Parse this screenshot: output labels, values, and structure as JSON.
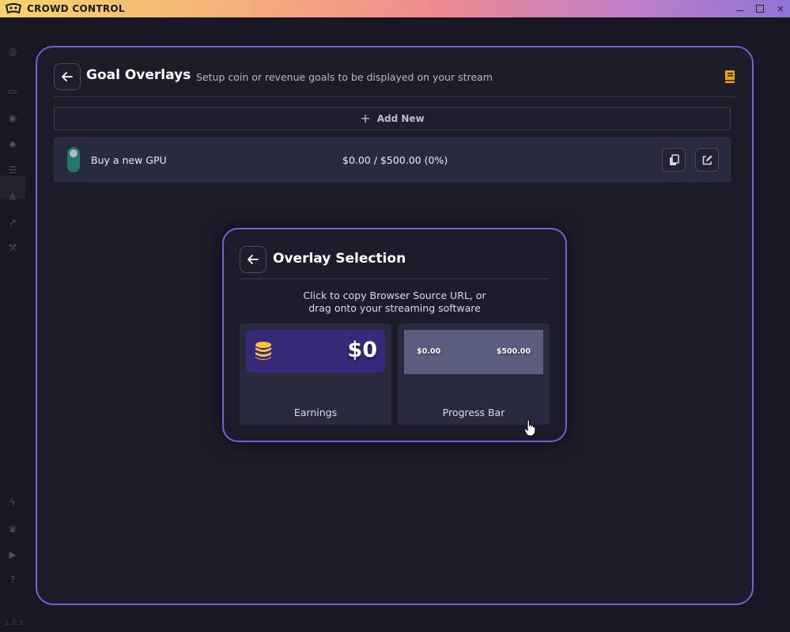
{
  "window": {
    "brand": "CROWD CONTROL"
  },
  "header": {
    "title": "Goal Overlays",
    "subtitle": "Setup coin or revenue goals to be displayed on your stream"
  },
  "actions": {
    "add_new_label": "Add New"
  },
  "goals": [
    {
      "name": "Buy a new GPU",
      "progress_text": "$0.00 / $500.00 (0%)",
      "enabled": true
    }
  ],
  "modal": {
    "title": "Overlay Selection",
    "instructions_line1": "Click to copy Browser Source URL, or",
    "instructions_line2": "drag onto your streaming software",
    "overlays": [
      {
        "label": "Earnings",
        "preview_amount": "$0"
      },
      {
        "label": "Progress Bar",
        "preview_start": "$0.00",
        "preview_end": "$500.00"
      }
    ]
  },
  "status": {
    "version": "1.2.3"
  },
  "colors": {
    "accent": "#6f62d6",
    "toggle": "#1f7a6a",
    "earnings_bg": "#37287a",
    "coin": "#f4c63d",
    "book": "#f0a316"
  },
  "icons": {
    "back": "arrow-left-icon",
    "book": "book-icon",
    "copy": "copy-icon",
    "edit": "edit-icon",
    "coins": "coins-icon"
  }
}
